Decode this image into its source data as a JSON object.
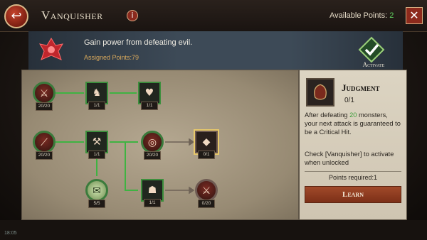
{
  "header": {
    "title": "Vanquisher",
    "points_label": "Available Points: ",
    "points_value": "2",
    "back_icon": "back-arrow-icon",
    "info_icon": "info-icon",
    "close_icon": "close-icon"
  },
  "band": {
    "description": "Gain power from defeating evil.",
    "assigned": "Assigned Points:79",
    "activate_label": "Activate"
  },
  "tree": {
    "nodes": [
      {
        "id": "n1",
        "shape": "round",
        "level": "20/20",
        "icon": "crossed-swords-icon",
        "locked": false,
        "glyph": "⚔"
      },
      {
        "id": "n2",
        "shape": "square",
        "level": "1/1",
        "icon": "warrior-silhouette-icon",
        "locked": false,
        "glyph": "♞"
      },
      {
        "id": "n3",
        "shape": "square",
        "level": "1/1",
        "icon": "heart-icon",
        "locked": false,
        "glyph": "♥"
      },
      {
        "id": "n4",
        "shape": "round",
        "level": "20/20",
        "icon": "claw-slash-icon",
        "locked": false,
        "glyph": "⟋"
      },
      {
        "id": "n5",
        "shape": "square",
        "level": "1/1",
        "icon": "battle-axe-icon",
        "locked": false,
        "glyph": "⚒"
      },
      {
        "id": "n6",
        "shape": "round",
        "level": "20/20",
        "icon": "vortex-icon",
        "locked": false,
        "glyph": "◎"
      },
      {
        "id": "n7",
        "shape": "square",
        "level": "0/1",
        "icon": "judgment-shield-icon",
        "locked": true,
        "glyph": "◆"
      },
      {
        "id": "n8",
        "shape": "round",
        "level": "5/5",
        "icon": "scroll-icon",
        "locked": false,
        "glyph": "✉"
      },
      {
        "id": "n9",
        "shape": "square",
        "level": "1/1",
        "icon": "warrior-aura-icon",
        "locked": false,
        "glyph": "☗"
      },
      {
        "id": "n10",
        "shape": "round",
        "level": "0/20",
        "icon": "crossed-swords-locked-icon",
        "locked": true,
        "glyph": "⚔"
      }
    ]
  },
  "detail": {
    "name": "Judgment",
    "level": "0/1",
    "desc_prefix": "After defeating ",
    "desc_number": "20",
    "desc_suffix": " monsters, your next attack is guaranteed to be a Critical Hit.",
    "note": "Check [Vanquisher] to activate when unlocked",
    "points_required": "Points required:1",
    "learn_label": "Learn"
  },
  "status": {
    "clock": "18:05"
  },
  "colors": {
    "accent_green": "#5fd35f",
    "button_red": "#8d2a1c"
  }
}
